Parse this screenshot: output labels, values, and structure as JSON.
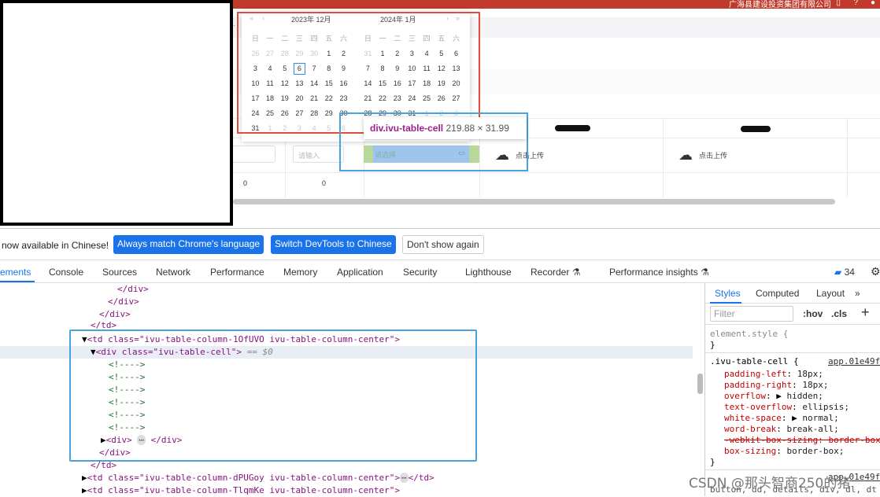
{
  "page": {
    "company": "广海县建设投资集团有限公司",
    "upload_label": "点击上传",
    "input_placeholder": "请输入",
    "select_placeholder": "请选择",
    "zero_values": [
      "0",
      "0"
    ]
  },
  "calendar": {
    "left_month": "2023年 12月",
    "right_month": "2024年 1月",
    "weekdays": [
      "日",
      "一",
      "二",
      "三",
      "四",
      "五",
      "六"
    ],
    "left_days": [
      "26",
      "27",
      "28",
      "29",
      "30",
      "1",
      "2",
      "3",
      "4",
      "5",
      "6",
      "7",
      "8",
      "9",
      "10",
      "11",
      "12",
      "13",
      "14",
      "15",
      "16",
      "17",
      "18",
      "19",
      "20",
      "21",
      "22",
      "23",
      "24",
      "25",
      "26",
      "27",
      "28",
      "29",
      "30",
      "31",
      "1",
      "2",
      "3",
      "4",
      "5",
      "6"
    ],
    "right_days": [
      "31",
      "1",
      "2",
      "3",
      "4",
      "5",
      "6",
      "7",
      "8",
      "9",
      "10",
      "11",
      "12",
      "13",
      "14",
      "15",
      "16",
      "17",
      "18",
      "19",
      "20",
      "21",
      "22",
      "23",
      "24",
      "25",
      "26",
      "27",
      "28",
      "29",
      "30",
      "31",
      "1",
      "2",
      "3"
    ],
    "selected_day": "6"
  },
  "inspector_tooltip": {
    "selector": "div.ivu-table-cell",
    "size": "219.88 × 31.99"
  },
  "devtools": {
    "infobar": {
      "message": "now available in Chinese!",
      "btn_match": "Always match Chrome's language",
      "btn_switch": "Switch DevTools to Chinese",
      "btn_dismiss": "Don't show again"
    },
    "tabs": [
      "Elements",
      "Console",
      "Sources",
      "Network",
      "Performance",
      "Memory",
      "Application",
      "Security",
      "Lighthouse",
      "Recorder",
      "Performance insights"
    ],
    "tab_elements_visible": "ements",
    "message_count": "34",
    "dom_lines": [
      "</div>",
      "</div>",
      "</div>",
      "</td>",
      "<td class=\"ivu-table-column-1OfUVO ivu-table-column-center\">",
      "<div class=\"ivu-table-cell\">",
      "== $0",
      "<!---->",
      "<div>",
      "</div>",
      "</div>",
      "</td>",
      "<td class=\"ivu-table-column-dPUGoy ivu-table-column-center\">",
      "</td>",
      "<td class=\"ivu-table-column-TlqmKe ivu-table-column-center\">"
    ],
    "styles": {
      "tabs": [
        "Styles",
        "Computed",
        "Layout"
      ],
      "filter_placeholder": "Filter",
      "hov": ":hov",
      "cls": ".cls",
      "element_style": "element.style {",
      "close_brace": "}",
      "rule_selector": ".ivu-table-cell {",
      "rule_source": "app.01e49f",
      "props": [
        {
          "name": "padding-left",
          "value": "18px;"
        },
        {
          "name": "padding-right",
          "value": "18px;"
        },
        {
          "name": "overflow",
          "value": "hidden;"
        },
        {
          "name": "text-overflow",
          "value": "ellipsis;"
        },
        {
          "name": "white-space",
          "value": "normal;"
        },
        {
          "name": "word-break",
          "value": "break-all;"
        },
        {
          "name": "-webkit-box-sizing",
          "value": "border-box"
        },
        {
          "name": "box-sizing",
          "value": "border-box;"
        }
      ],
      "next_source": "app.01e49f",
      "last_line": "button, dd, details, div, dl, dt"
    }
  },
  "watermark": "CSDN @那头智商250的猪"
}
